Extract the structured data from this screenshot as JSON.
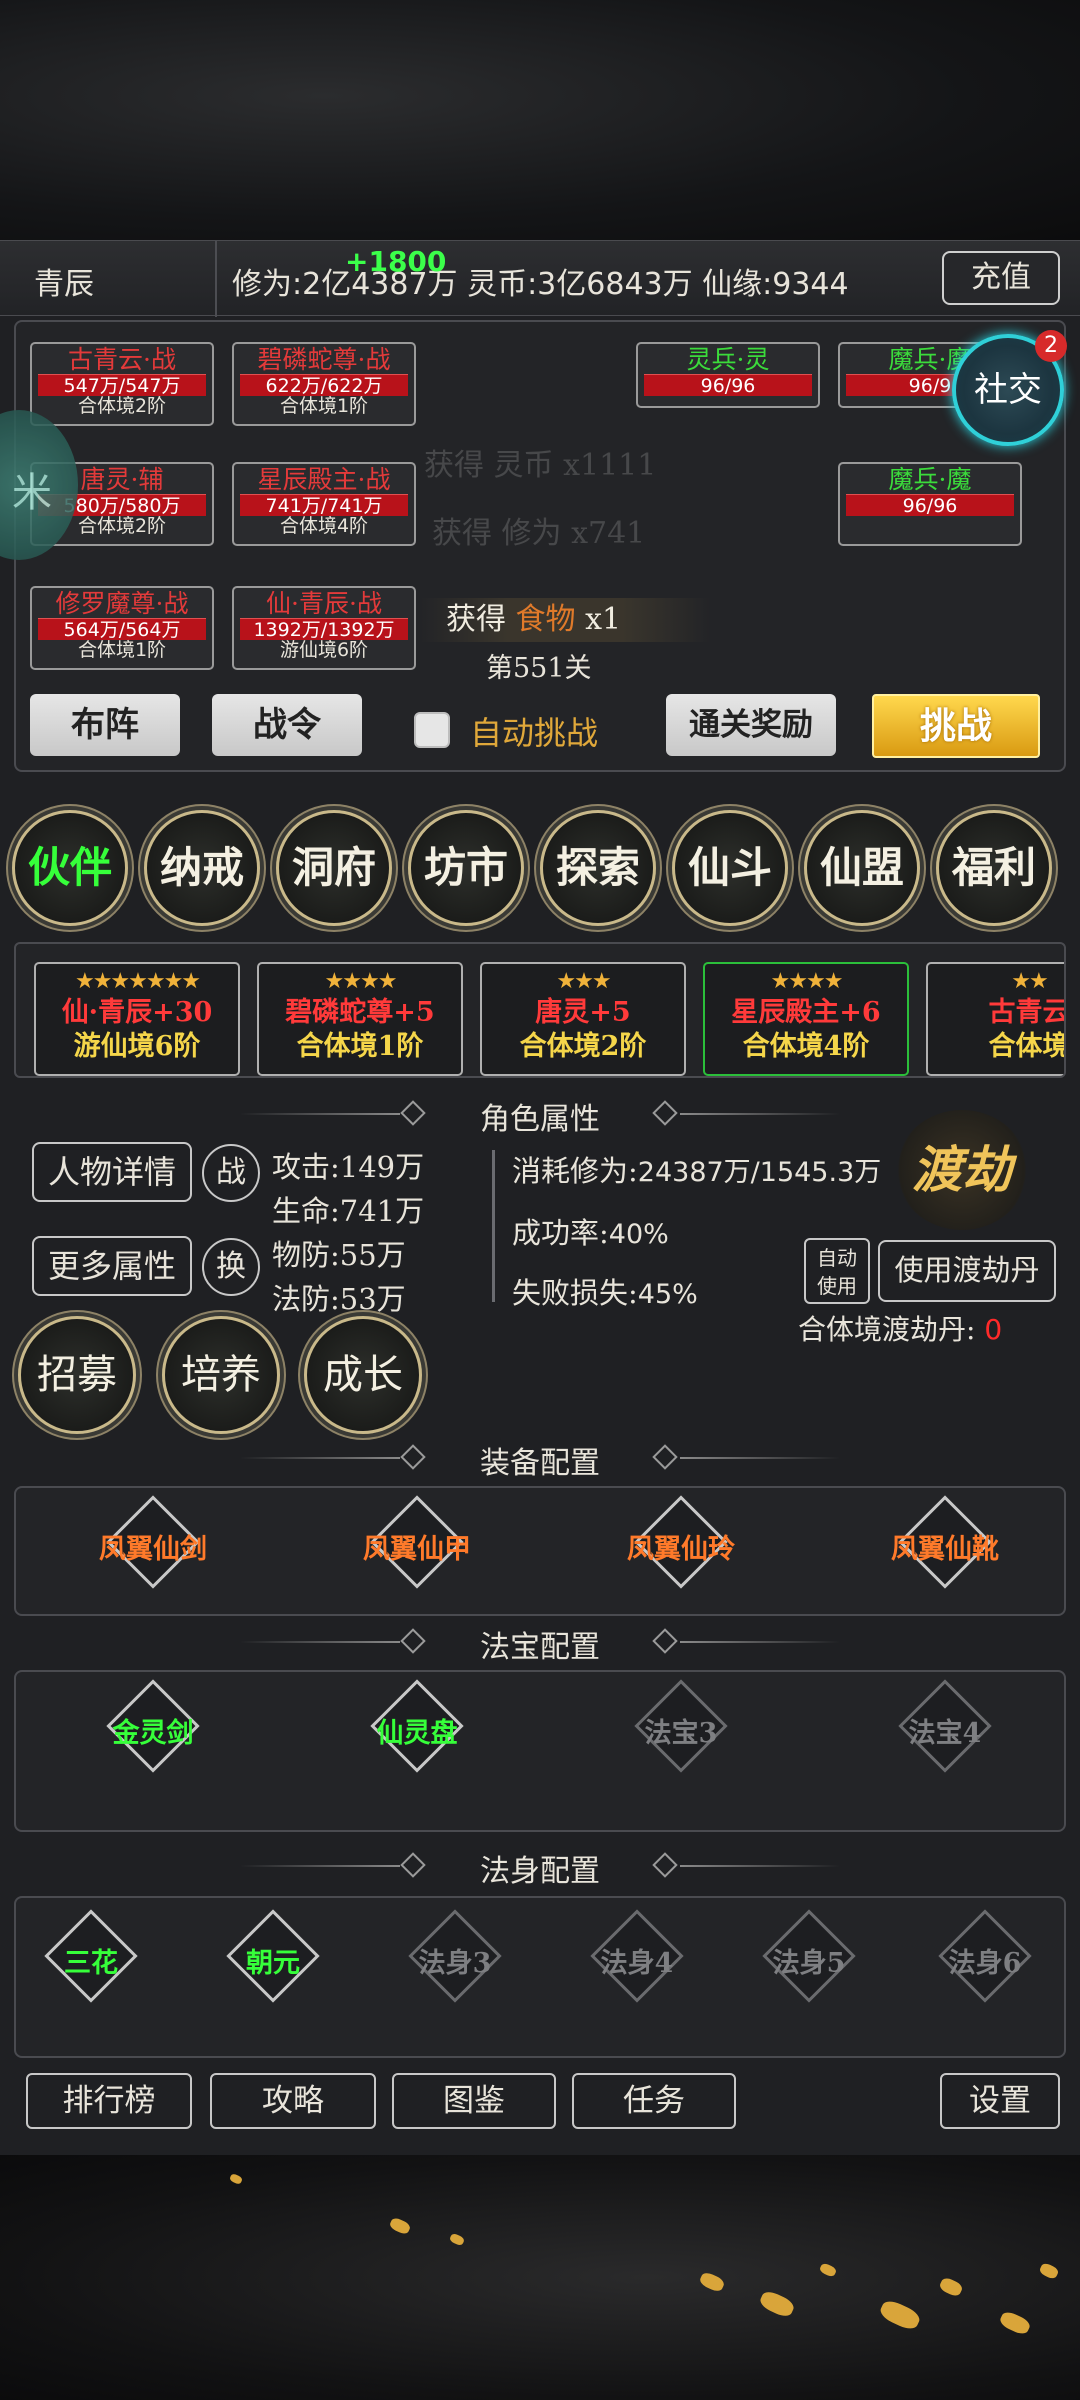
{
  "topbar": {
    "player_name": "青辰",
    "stats_text": "修为:2亿4387万  灵币:3亿6843万  仙缘:9344",
    "floating_gain": "+1800",
    "recharge_label": "充值"
  },
  "battle": {
    "allies": [
      {
        "name": "古青云·战",
        "hp": "547万/547万",
        "realm": "合体境2阶"
      },
      {
        "name": "碧磷蛇尊·战",
        "hp": "622万/622万",
        "realm": "合体境1阶"
      },
      {
        "name": "唐灵·辅",
        "hp": "580万/580万",
        "realm": "合体境2阶"
      },
      {
        "name": "星辰殿主·战",
        "hp": "741万/741万",
        "realm": "合体境4阶"
      },
      {
        "name": "修罗魔尊·战",
        "hp": "564万/564万",
        "realm": "合体境1阶"
      },
      {
        "name": "仙·青辰·战",
        "hp": "1392万/1392万",
        "realm": "游仙境6阶"
      }
    ],
    "enemies": [
      {
        "name": "灵兵·灵",
        "hp": "96/96"
      },
      {
        "name": "魔兵·魔",
        "hp": "96/9"
      },
      {
        "name": "魔兵·魔",
        "hp": "96/96"
      }
    ],
    "ghost_logs": [
      "获得 灵币 x1111",
      "获得 修为 x741"
    ],
    "gain_prefix": "获得",
    "gain_item": "食物",
    "gain_count": "x1",
    "stage_label": "第551关",
    "social_label": "社交",
    "social_badge": "2",
    "left_orb_label": "米",
    "formation_label": "布阵",
    "battlepass_label": "战令",
    "auto_challenge_label": "自动挑战",
    "clear_reward_label": "通关奖励",
    "challenge_label": "挑战"
  },
  "functions": [
    "伙伴",
    "纳戒",
    "洞府",
    "坊市",
    "探索",
    "仙斗",
    "仙盟",
    "福利"
  ],
  "partners": [
    {
      "stars": "★★★★★★★",
      "name": "仙·青辰+30",
      "realm": "游仙境6阶"
    },
    {
      "stars": "★★★★",
      "name": "碧磷蛇尊+5",
      "realm": "合体境1阶"
    },
    {
      "stars": "★★★",
      "name": "唐灵+5",
      "realm": "合体境2阶"
    },
    {
      "stars": "★★★★",
      "name": "星辰殿主+6",
      "realm": "合体境4阶"
    },
    {
      "stars": "★★",
      "name": "古青云",
      "realm": "合体境"
    }
  ],
  "attributes": {
    "section_title": "角色属性",
    "detail_label": "人物详情",
    "battle_tag": "战",
    "more_label": "更多属性",
    "swap_tag": "换",
    "attack": "攻击:149万",
    "life": "生命:741万",
    "phys_def": "物防:55万",
    "magic_def": "法防:53万",
    "cost_label": "消耗修为:",
    "cost_value": "24387万/1545.3万",
    "success_label": "成功率:",
    "success_value": "40%",
    "fail_label": "失败损失:",
    "fail_value": "45%",
    "tribulation_label": "渡劫",
    "auto_use_line1": "自动",
    "auto_use_line2": "使用",
    "use_pill_label": "使用渡劫丹",
    "pill_count_label": "合体境渡劫丹:",
    "pill_count": "0",
    "recruit_label": "招募",
    "train_label": "培养",
    "grow_label": "成长"
  },
  "equipment": {
    "title": "装备配置",
    "slots": [
      "凤翼仙剑",
      "凤翼仙甲",
      "凤翼仙玲",
      "凤翼仙靴"
    ]
  },
  "treasure": {
    "title": "法宝配置",
    "slots": [
      "金灵剑",
      "仙灵盘",
      "法宝3",
      "法宝4"
    ]
  },
  "body": {
    "title": "法身配置",
    "slots": [
      "三花",
      "朝元",
      "法身3",
      "法身4",
      "法身5",
      "法身6"
    ]
  },
  "bottom_nav": {
    "ranking": "排行榜",
    "guide": "攻略",
    "codex": "图鉴",
    "tasks": "任务",
    "settings": "设置"
  },
  "colors": {
    "hp_red": "#b8121a",
    "active_green": "#36ff3a",
    "gold": "#f0b23a",
    "orange": "#ff7a2a",
    "social_cyan": "#2fd0d8"
  }
}
